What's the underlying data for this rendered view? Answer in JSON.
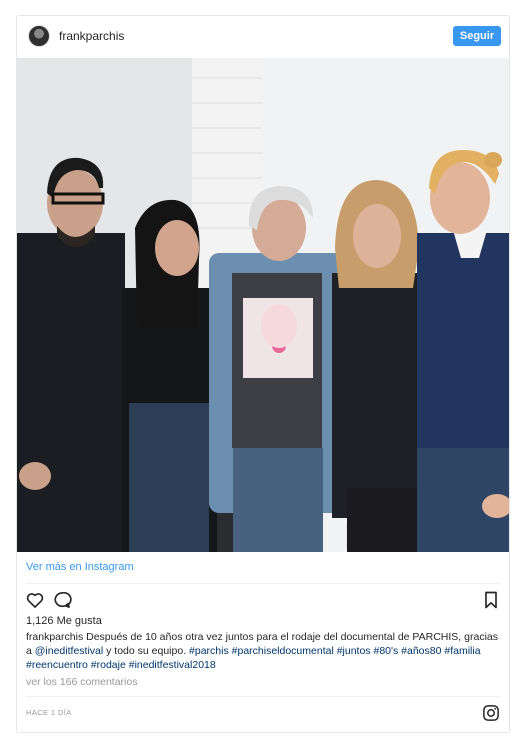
{
  "header": {
    "username": "frankparchis",
    "follow_label": "Seguir"
  },
  "post": {
    "view_more": "Ver más en Instagram",
    "likes": "1,126 Me gusta",
    "caption_user": "frankparchis",
    "caption_text": " Después de 10 años otra vez juntos para el rodaje del documental de PARCHIS, gracias a ",
    "mention": "@ineditfestival",
    "caption_text2": " y todo su equipo. ",
    "hashtags": "#parchis #parchiseldocumental #juntos #80's #años80 #familia #reencuentro #rodaje #ineditfestival2018",
    "comments": "ver los 166 comentarios",
    "time": "HACE 1 DÍA"
  },
  "icons": {
    "like": "heart-icon",
    "comment": "comment-icon",
    "save": "bookmark-icon",
    "brand": "instagram-icon"
  },
  "colors": {
    "accent": "#3897f0",
    "link": "#003569",
    "muted": "#999999"
  }
}
